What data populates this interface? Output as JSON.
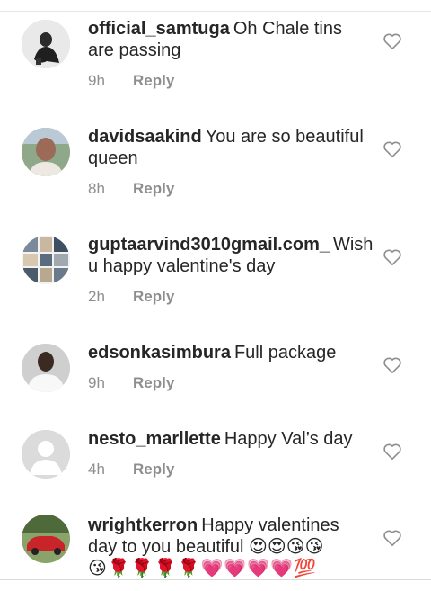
{
  "comments": [
    {
      "username": "official_samtuga",
      "text": "Oh Chale tins are passing",
      "time": "9h",
      "reply": "Reply",
      "avatar": "person-dark-avatar"
    },
    {
      "username": "davidsaakind",
      "text": "You are so beautiful queen",
      "time": "8h",
      "reply": "Reply",
      "avatar": "person-face-avatar"
    },
    {
      "username": "guptaarvind3010gmail.com_",
      "text": "Wish u happy valentine's day",
      "time": "2h",
      "reply": "Reply",
      "avatar": "collage-avatar"
    },
    {
      "username": "edsonkasimbura",
      "text": "Full package",
      "time": "9h",
      "reply": "Reply",
      "avatar": "person-white-shirt-avatar"
    },
    {
      "username": "nesto_marllette",
      "text": "Happy Val’s day",
      "time": "4h",
      "reply": "Reply",
      "avatar": "default-user-avatar"
    },
    {
      "username": "wrightkerron",
      "text": "Happy valentines day to you beautiful 😍😍😘😘",
      "text_line2": "😘🌹🌹🌹🌹💗💗💗💗💯",
      "avatar": "red-car-avatar"
    }
  ],
  "icons": {
    "like": "heart-outline-icon"
  },
  "colors": {
    "meta": "#8e8e8e",
    "text": "#262626",
    "divider": "#dbdbdb"
  }
}
